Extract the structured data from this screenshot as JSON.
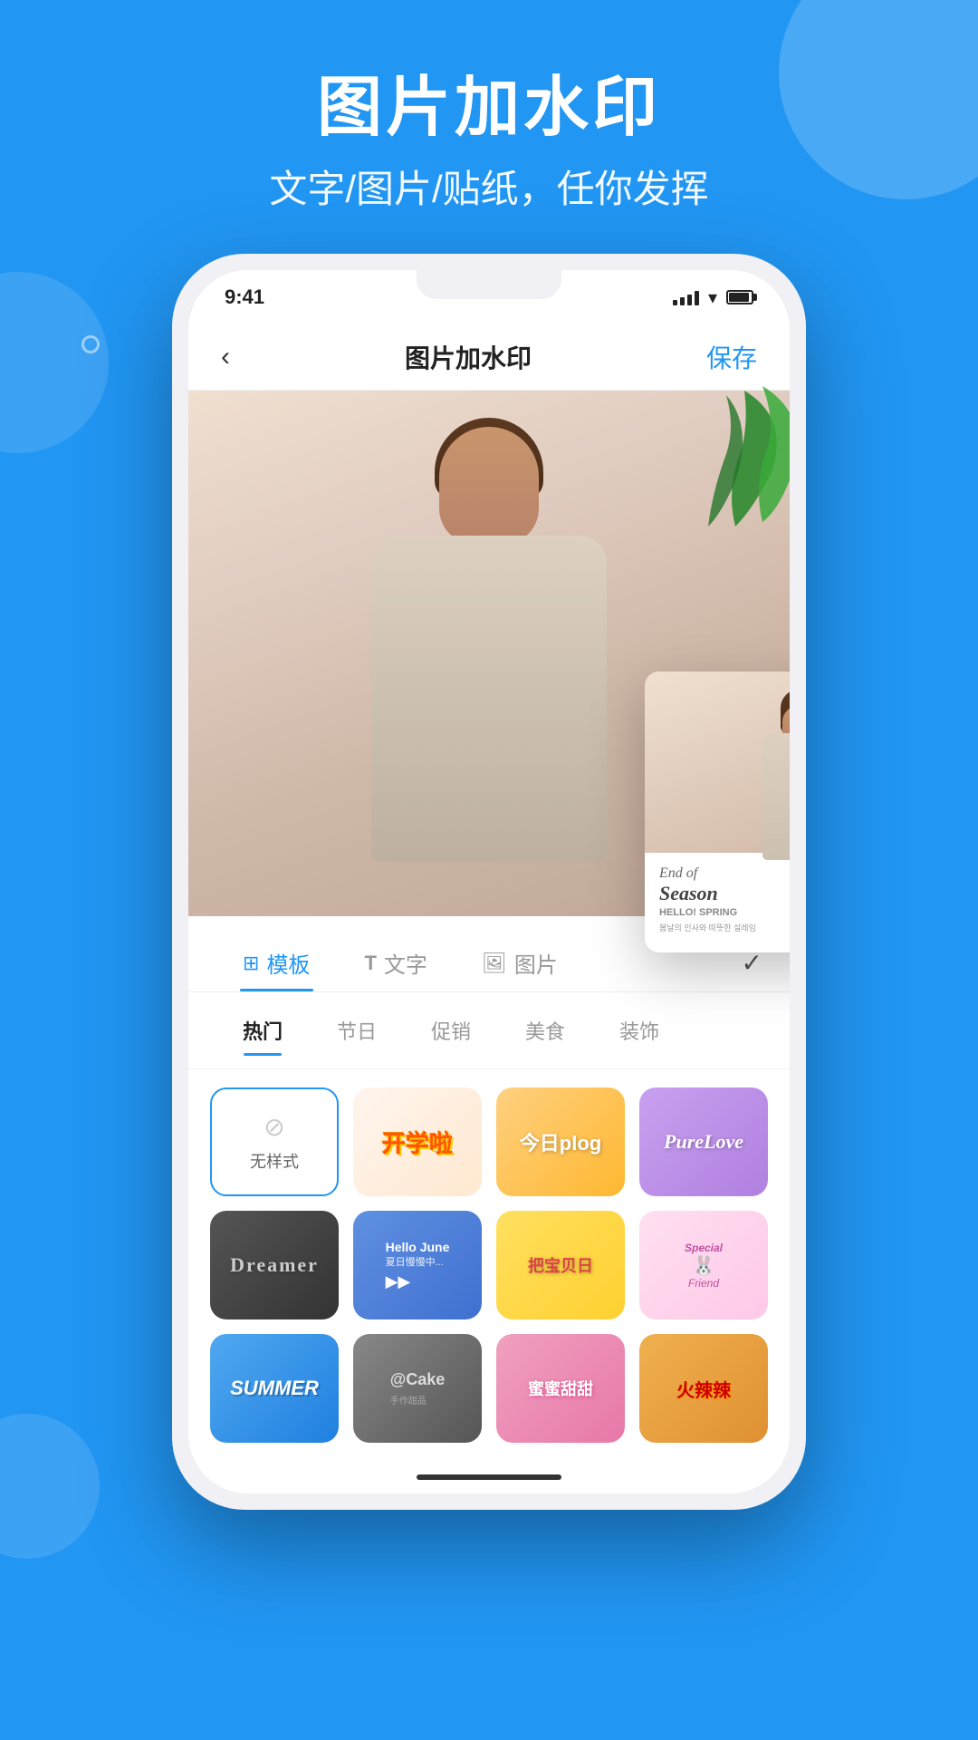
{
  "background_color": "#2196F3",
  "header": {
    "title": "图片加水印",
    "subtitle": "文字/图片/贴纸，任你发挥"
  },
  "status_bar": {
    "time": "9:41",
    "signal": "4 bars",
    "wifi": true,
    "battery": "full"
  },
  "app_bar": {
    "back_label": "‹",
    "title": "图片加水印",
    "save_label": "保存"
  },
  "tabs": [
    {
      "id": "template",
      "label": "模板",
      "icon": "template-icon",
      "active": true
    },
    {
      "id": "text",
      "label": "T 文字",
      "icon": "text-icon",
      "active": false
    },
    {
      "id": "image",
      "label": "图片",
      "icon": "image-icon",
      "active": false
    }
  ],
  "check_icon_label": "✓",
  "categories": [
    {
      "id": "hot",
      "label": "热门",
      "active": true
    },
    {
      "id": "holiday",
      "label": "节日",
      "active": false
    },
    {
      "id": "promo",
      "label": "促销",
      "active": false
    },
    {
      "id": "food",
      "label": "美食",
      "active": false
    },
    {
      "id": "decor",
      "label": "装饰",
      "active": false
    }
  ],
  "stickers": [
    {
      "id": "no-style",
      "label": "无样式",
      "style": "no-style",
      "row": 1
    },
    {
      "id": "kaixue",
      "label": "开学啦",
      "style": "kaixue",
      "row": 1
    },
    {
      "id": "plog",
      "label": "今日plog",
      "style": "plog",
      "row": 1
    },
    {
      "id": "love",
      "label": "PureLove",
      "style": "love",
      "row": 1
    },
    {
      "id": "dreamer",
      "label": "Dreamer",
      "style": "dreamer",
      "row": 2
    },
    {
      "id": "hello-june",
      "label": "Hello June 夏日慢慢中...",
      "style": "hello-june",
      "row": 2
    },
    {
      "id": "baobao",
      "label": "把宝贝日",
      "style": "baobao",
      "row": 2
    },
    {
      "id": "special",
      "label": "Special Friend",
      "style": "special",
      "row": 2
    },
    {
      "id": "summer",
      "label": "SUMMER",
      "style": "summer",
      "row": 3
    },
    {
      "id": "cake",
      "label": "@Cake",
      "style": "cake",
      "row": 3
    },
    {
      "id": "mimi",
      "label": "蜜蜜甜甜",
      "style": "mimi",
      "row": 3
    },
    {
      "id": "spicy",
      "label": "火辣辣",
      "style": "spicy",
      "row": 3
    }
  ],
  "preview_card": {
    "line1": "End of",
    "line2": "Season",
    "line3": "HELLO! SPRING",
    "small_text": "봄날의 인사와 따뜻한 설레임"
  }
}
